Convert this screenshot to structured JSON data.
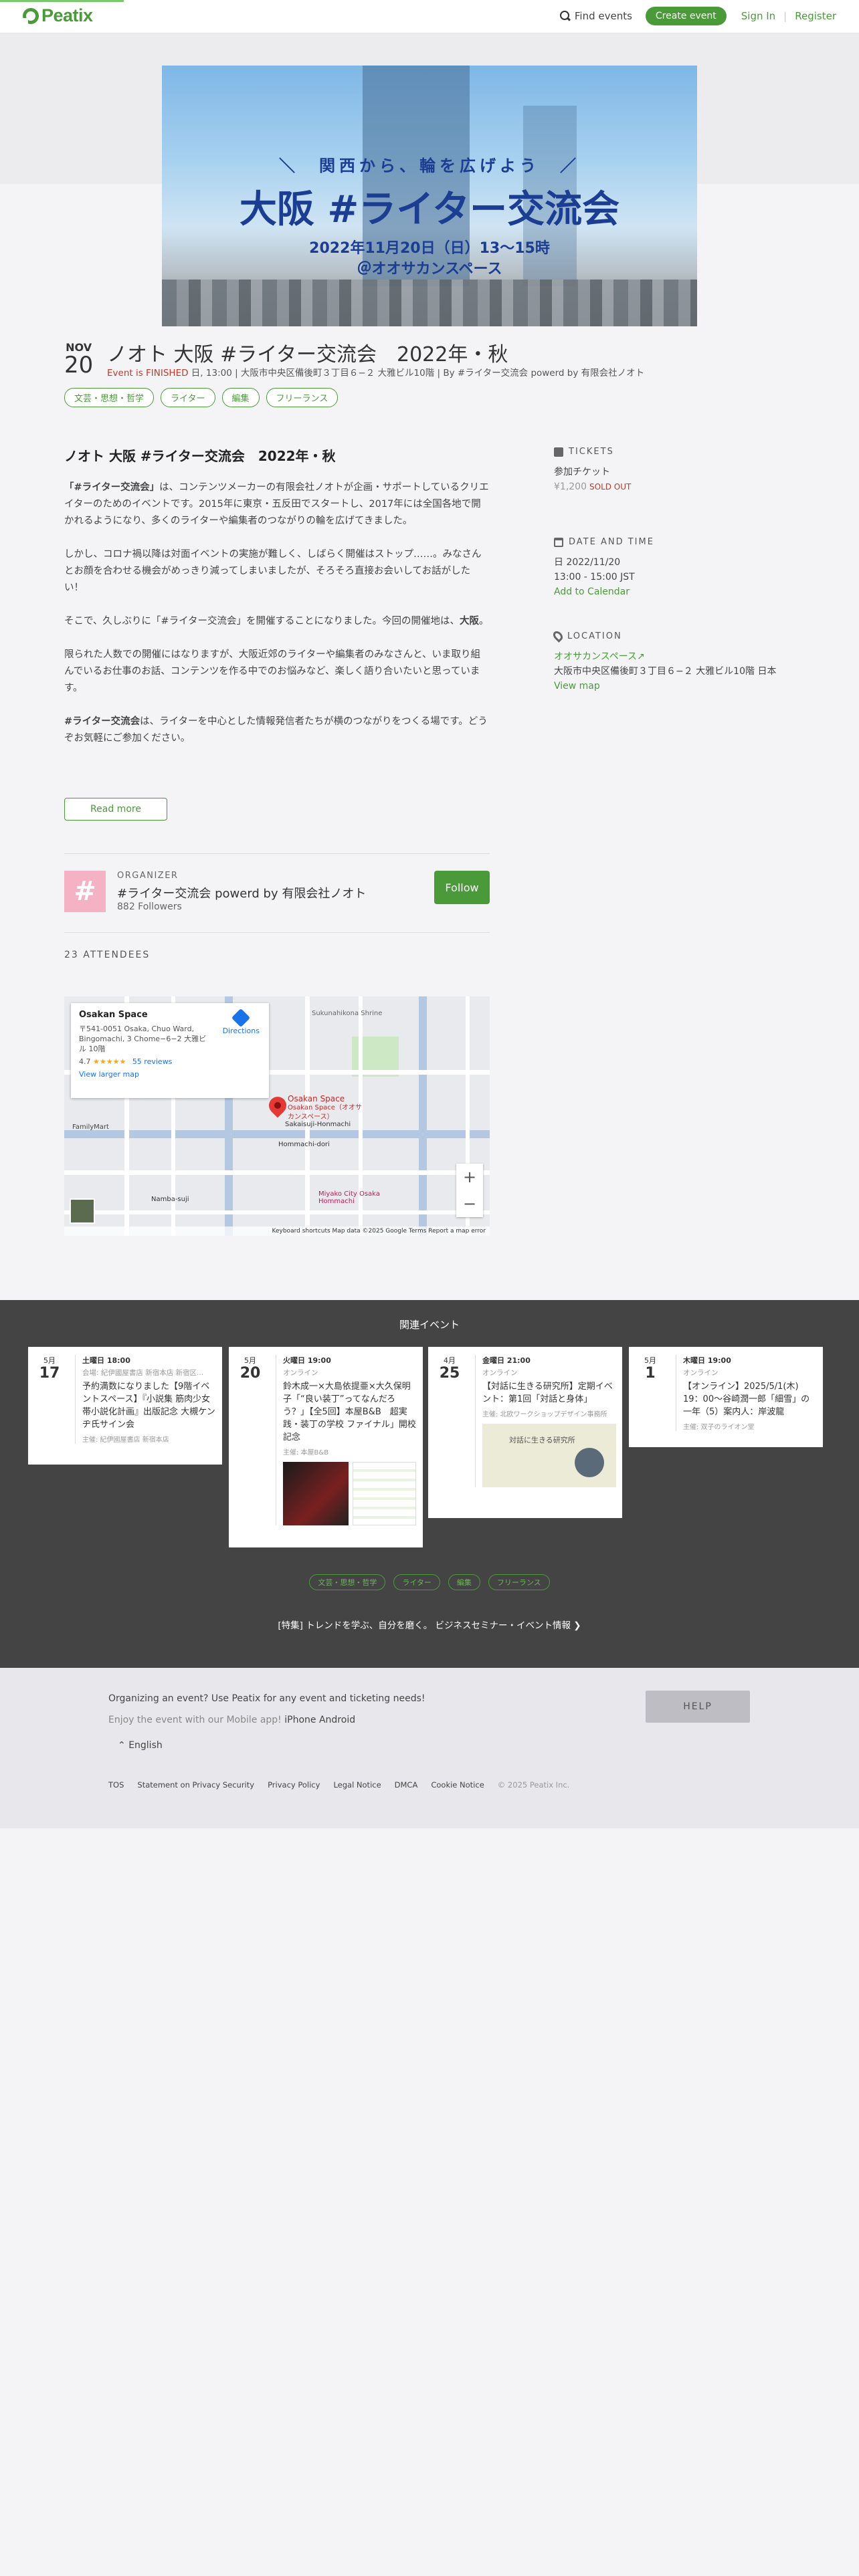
{
  "header": {
    "logo": "Peatix",
    "find_events": "Find events",
    "create_event": "Create event",
    "sign_in": "Sign In",
    "register": "Register",
    "separator": "|"
  },
  "banner": {
    "subtitle": "＼　関西から、輪を広げよう　／",
    "title": "大阪 #ライター交流会",
    "date": "2022年11月20日（日）13〜15時",
    "venue": "＠オオサカンスペース"
  },
  "event": {
    "month": "NOV",
    "day": "20",
    "title": "ノオト 大阪 #ライター交流会　2022年・秋",
    "status": "Event is FINISHED",
    "meta": " 日, 13:00 | 大阪市中央区備後町３丁目６−２ 大雅ビル10階 | By #ライター交流会 powerd by 有限会社ノオト",
    "tags": [
      "文芸・思想・哲学",
      "ライター",
      "編集",
      "フリーランス"
    ]
  },
  "description": {
    "heading": "ノオト 大阪 #ライター交流会　2022年・秋",
    "p1_bold": "「#ライター交流会」",
    "p1_rest": "は、コンテンツメーカーの有限会社ノオトが企画・サポートしているクリエイターのためのイベントです。2015年に東京・五反田でスタートし、2017年には全国各地で開かれるようになり、多くのライターや編集者のつながりの輪を広げてきました。",
    "p2": "しかし、コロナ禍以降は対面イベントの実施が難しく、しばらく開催はストップ……。みなさんとお顔を合わせる機会がめっきり減ってしまいましたが、そろそろ直接お会いしてお話がしたい！",
    "p3_a": "そこで、久しぶりに「#ライター交流会」を開催することになりました。今回の開催地は、",
    "p3_bold": "大阪",
    "p3_b": "。",
    "p4": "限られた人数での開催にはなりますが、大阪近郊のライターや編集者のみなさんと、いま取り組んでいるお仕事のお話、コンテンツを作る中でのお悩みなど、楽しく語り合いたいと思っています。",
    "p5_bold": "#ライター交流会",
    "p5_rest": "は、ライターを中心とした情報発信者たちが横のつながりをつくる場です。どうぞお気軽にご参加ください。",
    "read_more": "Read more"
  },
  "organizer": {
    "label": "ORGANIZER",
    "avatar": "#",
    "name": "#ライター交流会 powerd by 有限会社ノオト",
    "followers": "882 Followers",
    "follow": "Follow"
  },
  "attendees": "23 ATTENDEES",
  "map": {
    "place": "Osakan Space",
    "address": "〒541-0051 Osaka, Chuo Ward, Bingomachi, 3 Chome−6−2 大雅ビル 10階",
    "rating": "4.7",
    "stars": "★★★★★",
    "reviews": "55 reviews",
    "larger_map": "View larger map",
    "directions": "Directions",
    "pin_label": "Osakan Space",
    "pin_sub": "Osakan Space（オオサカンスペース）",
    "zoom_in": "+",
    "zoom_out": "−",
    "footer": "Keyboard shortcuts   Map data ©2025 Google   Terms   Report a map error",
    "labels": [
      "Sakaisuji-Honmachi",
      "Hommachi-dori",
      "Namba-suji",
      "Miyako City Osaka Hommachi",
      "FamilyMart",
      "Sukunahikona Shrine"
    ]
  },
  "tickets": {
    "heading": "TICKETS",
    "name": "参加チケット",
    "price": "¥1,200",
    "sold_out": "SOLD OUT"
  },
  "datetime": {
    "heading": "DATE AND TIME",
    "date": "日 2022/11/20",
    "time": "13:00 - 15:00 JST",
    "add_calendar": "Add to Calendar"
  },
  "location": {
    "heading": "LOCATION",
    "venue": "オオサカンスペース↗",
    "address": "大阪市中央区備後町３丁目６−２ 大雅ビル10階 日本",
    "view_map": "View map"
  },
  "related": {
    "title": "関連イベント",
    "events": [
      {
        "mon": "5月",
        "day": "17",
        "time": "土曜日 18:00",
        "loc": "会場: 紀伊國屋書店 新宿本店 新宿区...",
        "title": "予約満数になりました【9階イベントスペース】『小説集 筋肉少女帯小説化計画』出版記念 大槻ケンヂ氏サイン会",
        "host": "主催: 紀伊國屋書店 新宿本店"
      },
      {
        "mon": "5月",
        "day": "20",
        "time": "火曜日 19:00",
        "loc": "オンライン",
        "title": "鈴木成一×大島依提亜×大久保明子「“良い装丁”ってなんだろう？」【全5回】本屋B&B　超実践・装丁の学校 ファイナル」開校記念",
        "host": "主催: 本屋B&B"
      },
      {
        "mon": "4月",
        "day": "25",
        "time": "金曜日 21:00",
        "loc": "オンライン",
        "title": "【対話に生きる研究所】定期イベント：第1回「対話と身体」",
        "host": "主催: 北欧ワークショップデザイン事務所"
      },
      {
        "mon": "5月",
        "day": "1",
        "time": "木曜日 19:00",
        "loc": "オンライン",
        "title": "【オンライン】2025/5/1(木) 19：00〜谷崎潤一郎「細雪」の一年（5）案内人：岸波龍",
        "host": "主催: 双子のライオン堂"
      }
    ],
    "img_caption": "対話に生きる研究所",
    "tags": [
      "文芸・思想・哲学",
      "ライター",
      "編集",
      "フリーランス"
    ],
    "link": "[特集] トレンドを学ぶ、自分を磨く。 ビジネスセミナー・イベント情報 ❯"
  },
  "footer": {
    "organizing": "Organizing an event? Use Peatix for any event and ticketing needs!",
    "app_prefix": "Enjoy the event with our Mobile app!",
    "iphone": "iPhone",
    "android": "Android",
    "language": "English",
    "help": "HELP",
    "links": [
      "TOS",
      "Statement on Privacy Security",
      "Privacy Policy",
      "Legal Notice",
      "DMCA",
      "Cookie Notice"
    ],
    "copyright": "© 2025 Peatix Inc."
  },
  "colors": {
    "brand_green": "#4a9a3a",
    "finished_red": "#c0392b",
    "banner_blue": "#1b3d92"
  }
}
